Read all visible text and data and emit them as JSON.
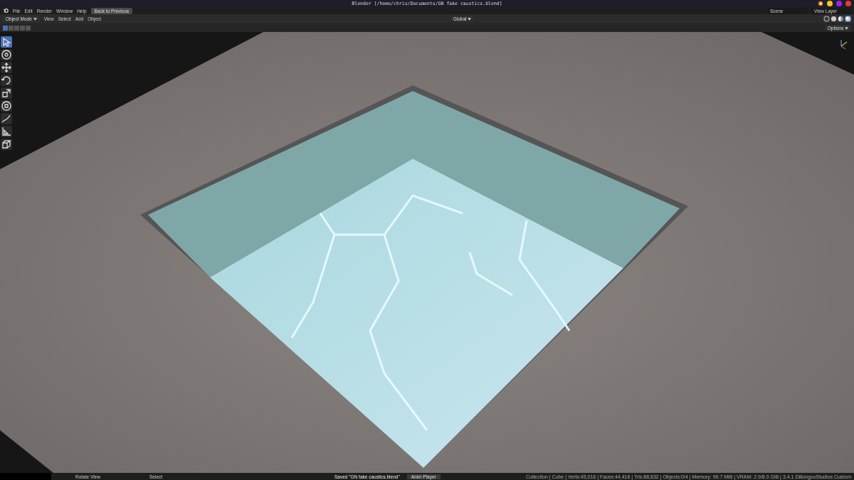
{
  "window": {
    "title": "Blender [/home/chris/Documents/GN fake caustics.blend]",
    "controls": [
      {
        "color": "#f5c518"
      },
      {
        "color": "#a020f0"
      },
      {
        "color": "#e53935"
      }
    ]
  },
  "menu": {
    "items": [
      "File",
      "Edit",
      "Render",
      "Window",
      "Help"
    ],
    "back_button": "Back to Previous",
    "scene": "Scene",
    "view_layer": "View Layer"
  },
  "header": {
    "mode": "Object Mode",
    "menus": [
      "View",
      "Select",
      "Add",
      "Object"
    ],
    "orientation": "Global",
    "shading": [
      {
        "kind": "wireframe",
        "selected": false
      },
      {
        "kind": "solid",
        "selected": false
      },
      {
        "kind": "material",
        "selected": false
      },
      {
        "kind": "rendered",
        "selected": true
      }
    ]
  },
  "tool_settings": {
    "select_modes": [
      {
        "selected": true
      },
      {
        "selected": false
      },
      {
        "selected": false
      },
      {
        "selected": false
      },
      {
        "selected": false
      }
    ],
    "options": "Options"
  },
  "toolbar": [
    {
      "kind": "select",
      "selected": true
    },
    {
      "kind": "cursor",
      "selected": false
    },
    {
      "kind": "move",
      "selected": false
    },
    {
      "kind": "rotate",
      "selected": false
    },
    {
      "kind": "scale",
      "selected": false
    },
    {
      "kind": "transform",
      "selected": false
    },
    {
      "kind": "annotate",
      "selected": false
    },
    {
      "kind": "measure",
      "selected": false
    },
    {
      "kind": "add-cube",
      "selected": false
    }
  ],
  "status_bar": {
    "hints": [
      "Rotate View",
      "Select"
    ],
    "message": "Saved \"GN fake caustics.blend\"",
    "job": "Anim Player",
    "stats": "Collection | Cube | Verts:45,016 | Faces:44,416 | Tris:88,832 | Objects:0/4 | Memory: 99.7 MiB | VRAM: 2.9/8.0 GiB | 3.4.1 DillongooStudios Custom"
  }
}
